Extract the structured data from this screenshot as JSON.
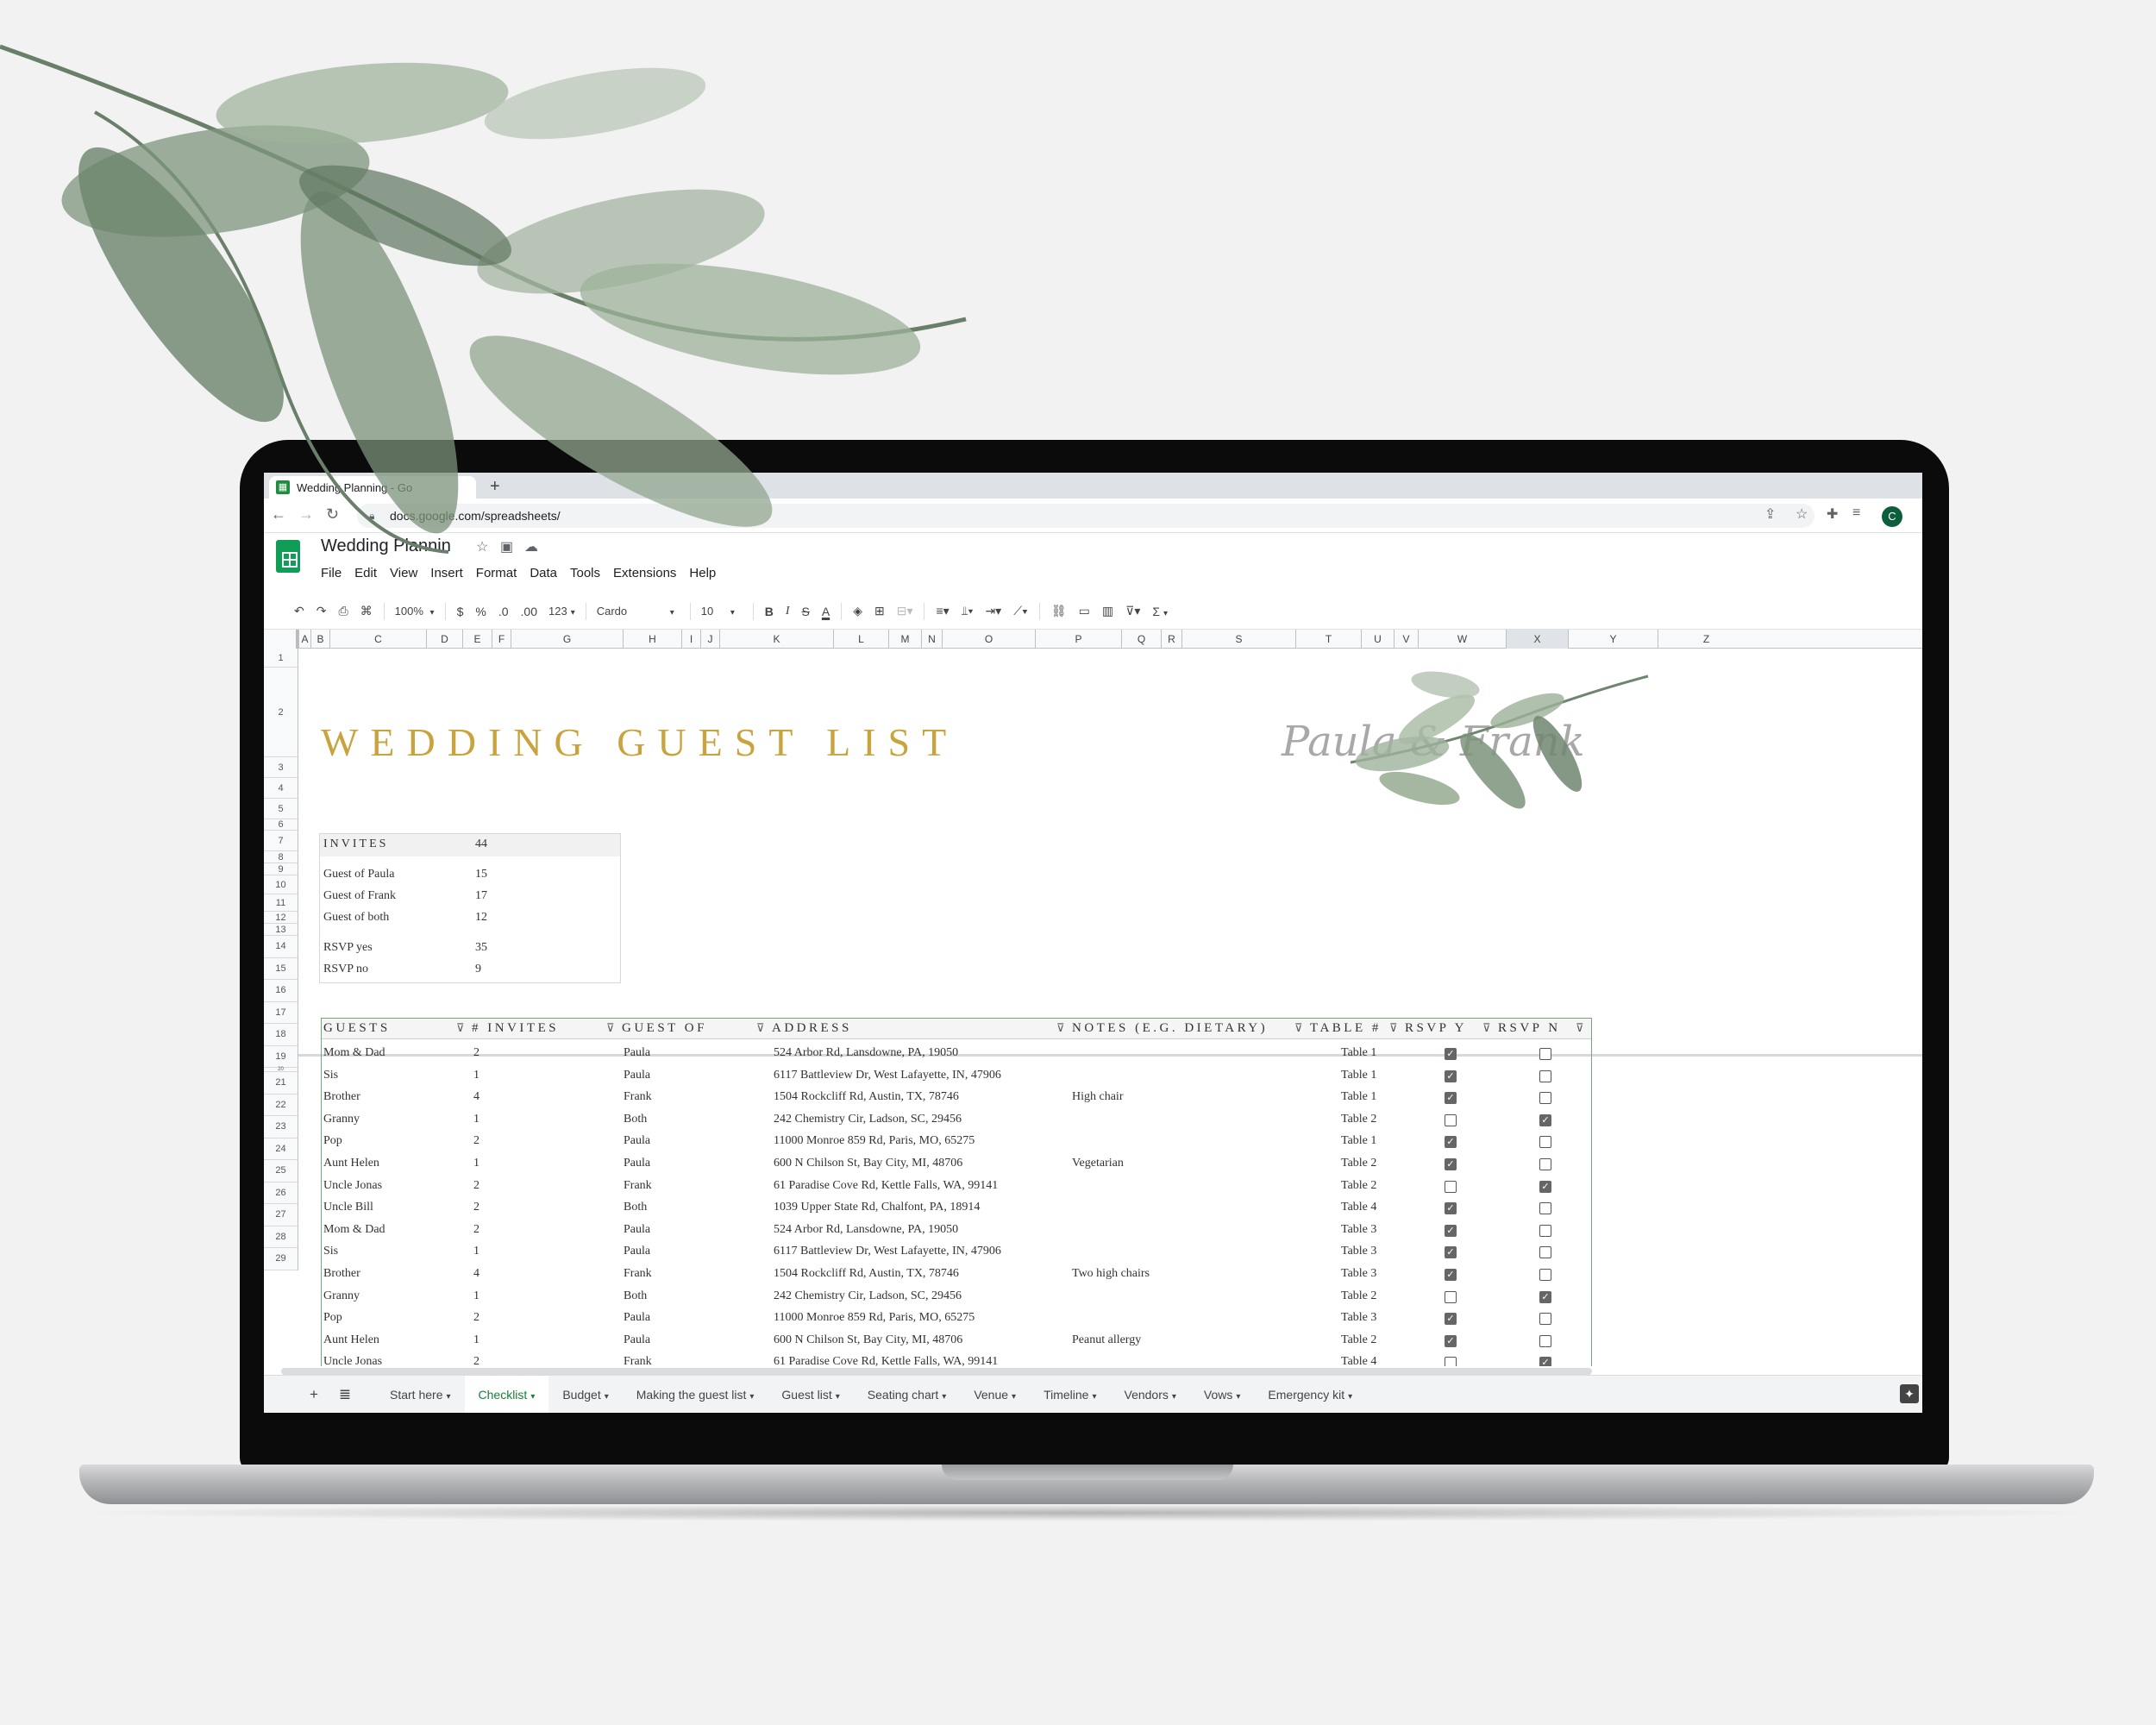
{
  "browser": {
    "tab_title": "Wedding Planning - Go",
    "new_tab": "+",
    "url": "docs.google.com/spreadsheets/",
    "profile_initial": "C"
  },
  "doc": {
    "title": "Wedding Plannin",
    "menu": [
      "File",
      "Edit",
      "View",
      "Insert",
      "Format",
      "Data",
      "Tools",
      "Extensions",
      "Help"
    ]
  },
  "toolbar": {
    "zoom": "100%",
    "currency": "$",
    "percent": "%",
    "decrease_decimal": ".0",
    "increase_decimal": ".00",
    "more_formats": "123",
    "font_family": "Cardo",
    "font_size": "10",
    "bold": "B",
    "italic": "I",
    "strikethrough": "S",
    "text_color": "A",
    "sum": "Σ"
  },
  "columns": [
    "A",
    "B",
    "C",
    "D",
    "E",
    "F",
    "G",
    "H",
    "I",
    "J",
    "K",
    "L",
    "M",
    "N",
    "O",
    "P",
    "Q",
    "R",
    "S",
    "T",
    "U",
    "V",
    "W",
    "X",
    "Y",
    "Z"
  ],
  "rows": [
    "1",
    "2",
    "3",
    "4",
    "5",
    "6",
    "7",
    "8",
    "9",
    "10",
    "11",
    "12",
    "13",
    "14",
    "15",
    "16",
    "17",
    "18",
    "19",
    "20",
    "21",
    "22",
    "23",
    "24",
    "25",
    "26",
    "27",
    "28",
    "29"
  ],
  "sheet": {
    "heading": "WEDDING GUEST LIST",
    "couple": "Paula & Frank",
    "summary": {
      "title": "INVITES",
      "total": "44",
      "rows": [
        {
          "label": "Guest of Paula",
          "value": "15"
        },
        {
          "label": "Guest of Frank",
          "value": "17"
        },
        {
          "label": "Guest of both",
          "value": "12"
        },
        {
          "label": "RSVP yes",
          "value": "35"
        },
        {
          "label": "RSVP no",
          "value": "9"
        }
      ]
    },
    "table_headers": [
      "GUESTS",
      "# INVITES",
      "GUEST OF",
      "ADDRESS",
      "NOTES (E.G. DIETARY)",
      "TABLE #",
      "RSVP Y",
      "RSVP N"
    ],
    "guests": [
      {
        "name": "Mom & Dad",
        "invites": "2",
        "guest_of": "Paula",
        "address": "524 Arbor Rd, Lansdowne, PA, 19050",
        "notes": "",
        "table": "Table 1",
        "rsvp_y": true,
        "rsvp_n": false
      },
      {
        "name": "Sis",
        "invites": "1",
        "guest_of": "Paula",
        "address": "6117 Battleview Dr, West Lafayette, IN, 47906",
        "notes": "",
        "table": "Table 1",
        "rsvp_y": true,
        "rsvp_n": false
      },
      {
        "name": "Brother",
        "invites": "4",
        "guest_of": "Frank",
        "address": "1504 Rockcliff Rd, Austin, TX, 78746",
        "notes": "High chair",
        "table": "Table 1",
        "rsvp_y": true,
        "rsvp_n": false
      },
      {
        "name": "Granny",
        "invites": "1",
        "guest_of": "Both",
        "address": "242 Chemistry Cir, Ladson, SC, 29456",
        "notes": "",
        "table": "Table 2",
        "rsvp_y": false,
        "rsvp_n": true
      },
      {
        "name": "Pop",
        "invites": "2",
        "guest_of": "Paula",
        "address": "11000 Monroe 859 Rd, Paris, MO, 65275",
        "notes": "",
        "table": "Table 1",
        "rsvp_y": true,
        "rsvp_n": false
      },
      {
        "name": "Aunt Helen",
        "invites": "1",
        "guest_of": "Paula",
        "address": "600 N Chilson St, Bay City, MI, 48706",
        "notes": "Vegetarian",
        "table": "Table 2",
        "rsvp_y": true,
        "rsvp_n": false
      },
      {
        "name": "Uncle Jonas",
        "invites": "2",
        "guest_of": "Frank",
        "address": "61 Paradise Cove Rd, Kettle Falls, WA, 99141",
        "notes": "",
        "table": "Table 2",
        "rsvp_y": false,
        "rsvp_n": true
      },
      {
        "name": "Uncle Bill",
        "invites": "2",
        "guest_of": "Both",
        "address": "1039 Upper State Rd, Chalfont, PA, 18914",
        "notes": "",
        "table": "Table 4",
        "rsvp_y": true,
        "rsvp_n": false
      },
      {
        "name": "Mom & Dad",
        "invites": "2",
        "guest_of": "Paula",
        "address": "524 Arbor Rd, Lansdowne, PA, 19050",
        "notes": "",
        "table": "Table 3",
        "rsvp_y": true,
        "rsvp_n": false
      },
      {
        "name": "Sis",
        "invites": "1",
        "guest_of": "Paula",
        "address": "6117 Battleview Dr, West Lafayette, IN, 47906",
        "notes": "",
        "table": "Table 3",
        "rsvp_y": true,
        "rsvp_n": false
      },
      {
        "name": "Brother",
        "invites": "4",
        "guest_of": "Frank",
        "address": "1504 Rockcliff Rd, Austin, TX, 78746",
        "notes": "Two high chairs",
        "table": "Table 3",
        "rsvp_y": true,
        "rsvp_n": false
      },
      {
        "name": "Granny",
        "invites": "1",
        "guest_of": "Both",
        "address": "242 Chemistry Cir, Ladson, SC, 29456",
        "notes": "",
        "table": "Table 2",
        "rsvp_y": false,
        "rsvp_n": true
      },
      {
        "name": "Pop",
        "invites": "2",
        "guest_of": "Paula",
        "address": "11000 Monroe 859 Rd, Paris, MO, 65275",
        "notes": "",
        "table": "Table 3",
        "rsvp_y": true,
        "rsvp_n": false
      },
      {
        "name": "Aunt Helen",
        "invites": "1",
        "guest_of": "Paula",
        "address": "600 N Chilson St, Bay City, MI, 48706",
        "notes": "Peanut allergy",
        "table": "Table 2",
        "rsvp_y": true,
        "rsvp_n": false
      },
      {
        "name": "Uncle Jonas",
        "invites": "2",
        "guest_of": "Frank",
        "address": "61 Paradise Cove Rd, Kettle Falls, WA, 99141",
        "notes": "",
        "table": "Table 4",
        "rsvp_y": false,
        "rsvp_n": true
      }
    ]
  },
  "sheet_tabs": [
    {
      "label": "Start here",
      "active": false
    },
    {
      "label": "Checklist",
      "active": true
    },
    {
      "label": "Budget",
      "active": false
    },
    {
      "label": "Making the guest list",
      "active": false
    },
    {
      "label": "Guest list",
      "active": false
    },
    {
      "label": "Seating chart",
      "active": false
    },
    {
      "label": "Venue",
      "active": false
    },
    {
      "label": "Timeline",
      "active": false
    },
    {
      "label": "Vendors",
      "active": false
    },
    {
      "label": "Vows",
      "active": false
    },
    {
      "label": "Emergency kit",
      "active": false
    }
  ],
  "colors": {
    "heading_gold": "#c9a43e",
    "sheets_green": "#0f9d58",
    "active_tab_green": "#188038",
    "leaf_green": "#8fa88c"
  }
}
